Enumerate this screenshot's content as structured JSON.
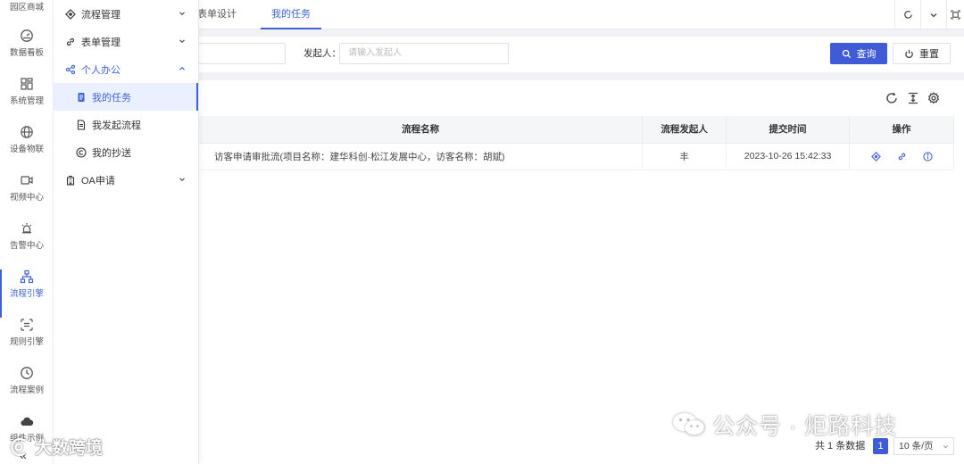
{
  "rail": {
    "top_label": "园区商城",
    "items": [
      {
        "label": "数据看板",
        "icon": "dashboard-icon"
      },
      {
        "label": "系统管理",
        "icon": "grid-icon"
      },
      {
        "label": "设备物联",
        "icon": "globe-icon"
      },
      {
        "label": "视频中心",
        "icon": "video-icon"
      },
      {
        "label": "告警中心",
        "icon": "alarm-icon"
      },
      {
        "label": "流程引擎",
        "icon": "workflow-icon"
      },
      {
        "label": "规则引擎",
        "icon": "rules-icon"
      },
      {
        "label": "流程案例",
        "icon": "clock-icon"
      },
      {
        "label": "组件示例",
        "icon": "cloud-icon"
      }
    ],
    "collapse": "«",
    "active": "流程引擎"
  },
  "submenu": {
    "items": [
      {
        "label": "流程管理",
        "icon": "process-icon"
      },
      {
        "label": "表单管理",
        "icon": "link-icon"
      },
      {
        "label": "个人办公",
        "icon": "share-icon"
      },
      {
        "label": "我的任务",
        "icon": "task-icon"
      },
      {
        "label": "我发起流程",
        "icon": "document-icon"
      },
      {
        "label": "我的抄送",
        "icon": "copyright-icon"
      },
      {
        "label": "OA申请",
        "icon": "building-icon"
      }
    ]
  },
  "tabs": [
    "表单设计",
    "我的任务"
  ],
  "active_tab": "我的任务",
  "filter": {
    "initiator_label": "发起人：",
    "initiator_placeholder": "请输入发起人",
    "search_label": "查询",
    "reset_label": "重置"
  },
  "table": {
    "columns": [
      "流程名称",
      "流程发起人",
      "提交时间",
      "操作"
    ],
    "rows": [
      {
        "name": "访客申请审批流(项目名称：建华科创·松江发展中心，访客名称：胡斌)",
        "initiator": "丰",
        "time": "2023-10-26 15:42:33"
      }
    ]
  },
  "pagination": {
    "total_text": "共 1 条数据",
    "current_page": "1",
    "page_size": "10 条/页"
  },
  "watermarks": {
    "bottom_left": "大数跨境",
    "bottom_right": "公众号 · 炬路科技"
  },
  "colors": {
    "accent": "#3f5bd6",
    "background": "#f0f2f5"
  }
}
